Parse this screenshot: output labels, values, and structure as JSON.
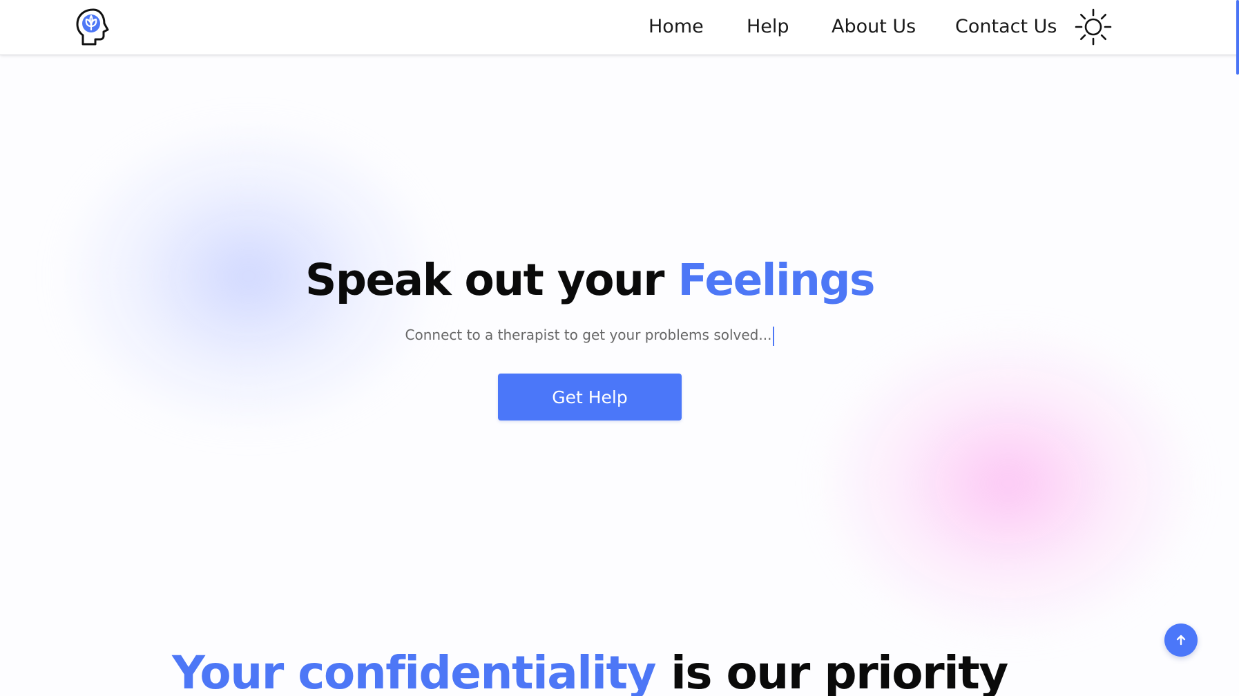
{
  "nav": {
    "logo_icon": "mind-leaf-icon",
    "items": [
      {
        "label": "Home"
      },
      {
        "label": "Help"
      },
      {
        "label": "About Us"
      },
      {
        "label": "Contact Us"
      }
    ],
    "theme_icon": "sun-icon"
  },
  "hero": {
    "title_main": "Speak out your ",
    "title_accent": "Feelings",
    "subtitle": "Connect to a therapist to get your problems solved...",
    "cta_label": "Get Help"
  },
  "section": {
    "title_accent": "Your confidentiality",
    "title_main": "is our priority"
  },
  "scroll_top_icon": "arrow-up-icon",
  "colors": {
    "accent": "#4d77f6",
    "button": "#4b77f9",
    "blob_blue": "#ced6ff",
    "blob_pink": "#fcc4f4"
  }
}
